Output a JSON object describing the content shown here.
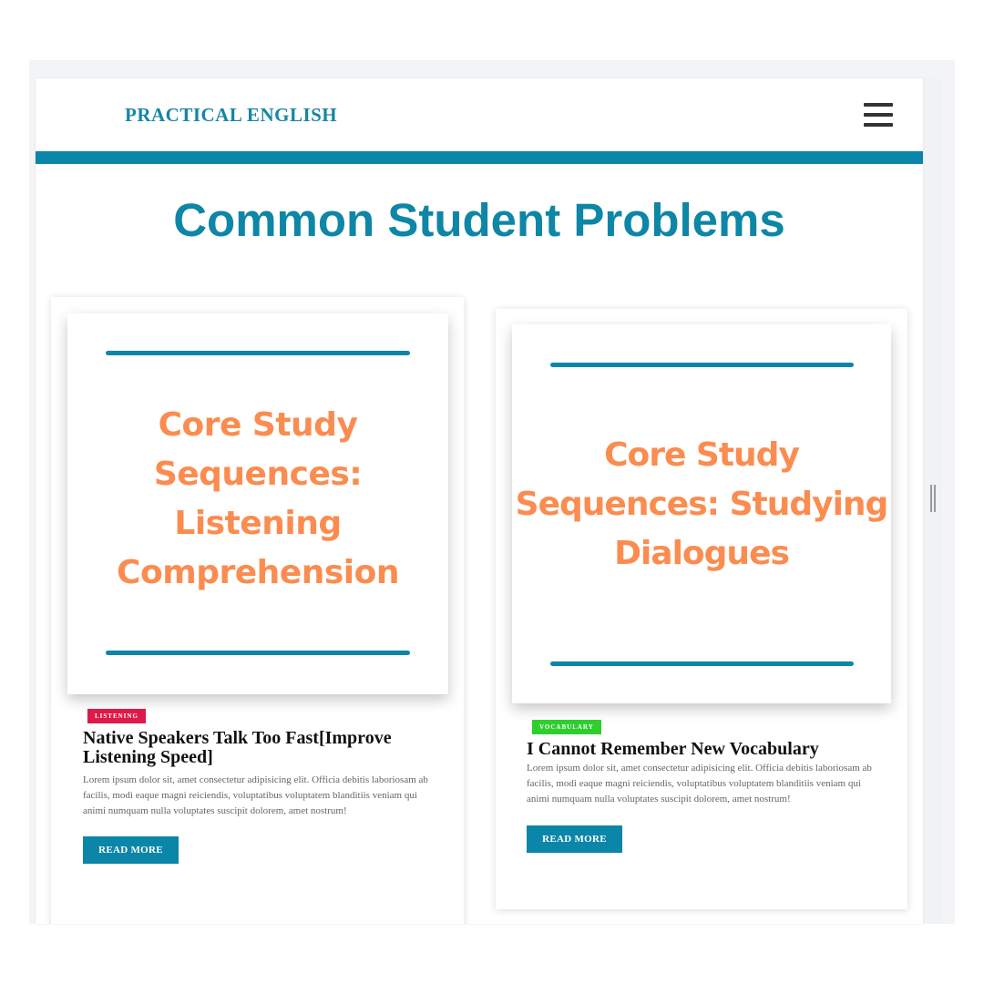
{
  "header": {
    "brand": "PRACTICAL ENGLISH",
    "menu_icon": "hamburger-menu-icon",
    "accent_color": "#0b86a8"
  },
  "main": {
    "title": "Common Student Problems"
  },
  "posts": [
    {
      "image_text": "Core Study\nSequences:\nListening\nComprehension",
      "category": "LISTENING",
      "category_color": "#de1a48",
      "title": "Native Speakers Talk Too Fast[Improve Listening Speed]",
      "excerpt": "Lorem ipsum dolor sit, amet consectetur adipisicing elit. Officia debitis laboriosam ab facilis, modi eaque magni reiciendis, voluptatibus voluptatem blanditiis veniam qui animi numquam nulla voluptates suscipit dolorem, amet nostrum!",
      "button_label": "READ MORE"
    },
    {
      "image_text": "Core Study\nSequences: Studying\nDialogues",
      "category": "VOCABULARY",
      "category_color": "#2fce2f",
      "title": "I Cannot Remember New Vocabulary",
      "excerpt": "Lorem ipsum dolor sit, amet consectetur adipisicing elit. Officia debitis laboriosam ab facilis, modi eaque magni reiciendis, voluptatibus voluptatem blanditiis veniam qui animi numquam nulla voluptates suscipit dolorem, amet nostrum!",
      "button_label": "READ MORE"
    }
  ],
  "colors": {
    "title_text": "#0e86a6",
    "image_text": "#fb8c50"
  }
}
